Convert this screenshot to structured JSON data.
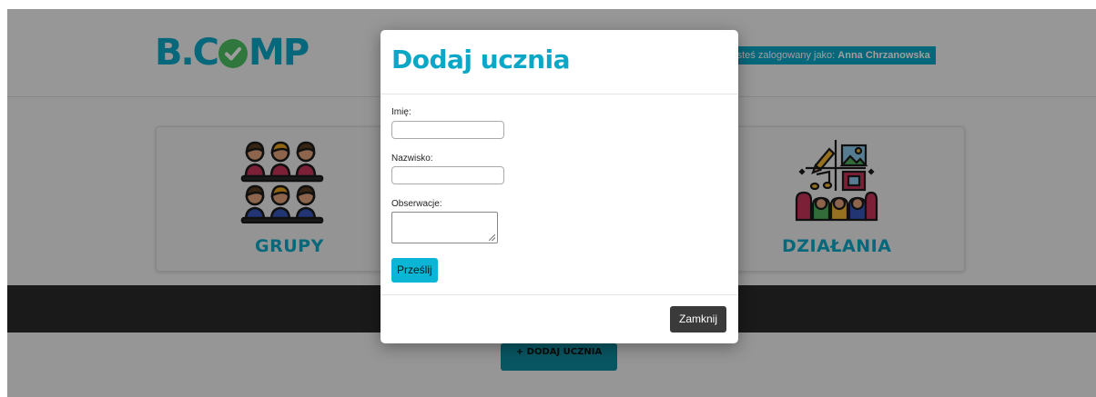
{
  "header": {
    "logo_text_left": "B.C",
    "logo_text_right": "MP",
    "logged_in_prefix": "Jesteś zalogowany jako:",
    "logged_in_user": "Anna Chrzanowska"
  },
  "cards": {
    "groups": {
      "title": "GRUPY",
      "icon": "people-group-icon"
    },
    "actions": {
      "title": "DZIAŁANIA",
      "icon": "creative-activities-icon"
    }
  },
  "add_student_button": {
    "icon": "plus-icon",
    "label": "DODAJ UCZNIA",
    "plus": "+"
  },
  "modal": {
    "title": "Dodaj ucznia",
    "fields": {
      "first_name": {
        "label": "Imię:",
        "value": ""
      },
      "last_name": {
        "label": "Nazwisko:",
        "value": ""
      },
      "notes": {
        "label": "Obserwacje:",
        "value": ""
      }
    },
    "submit_label": "Prześlij",
    "close_label": "Zamknij"
  },
  "colors": {
    "accent": "#0aa8c6",
    "check_green": "#4cc061",
    "dark_bar": "#2b2b2b",
    "close_button": "#3a3a3a"
  }
}
